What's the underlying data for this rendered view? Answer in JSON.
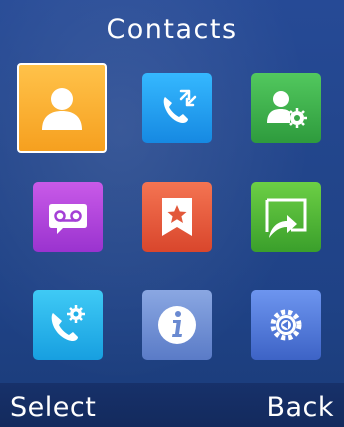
{
  "screen": {
    "title": "Contacts"
  },
  "menu": {
    "items": [
      {
        "icon": "contacts-person-icon",
        "selected": true,
        "color": "#f5a623"
      },
      {
        "icon": "call-transfer-icon",
        "selected": false,
        "color": "#1e9bea"
      },
      {
        "icon": "contact-settings-icon",
        "selected": false,
        "color": "#3fb34f"
      },
      {
        "icon": "voicemail-icon",
        "selected": false,
        "color": "#a43fd6"
      },
      {
        "icon": "bookmark-star-icon",
        "selected": false,
        "color": "#e2583a"
      },
      {
        "icon": "forward-arrow-icon",
        "selected": false,
        "color": "#4cb33a"
      },
      {
        "icon": "call-settings-icon",
        "selected": false,
        "color": "#1fb0e8"
      },
      {
        "icon": "info-icon",
        "selected": false,
        "color": "#6a8ad1"
      },
      {
        "icon": "system-settings-icon",
        "selected": false,
        "color": "#4f78d8"
      }
    ]
  },
  "softkeys": {
    "left_label": "Select",
    "right_label": "Back"
  }
}
